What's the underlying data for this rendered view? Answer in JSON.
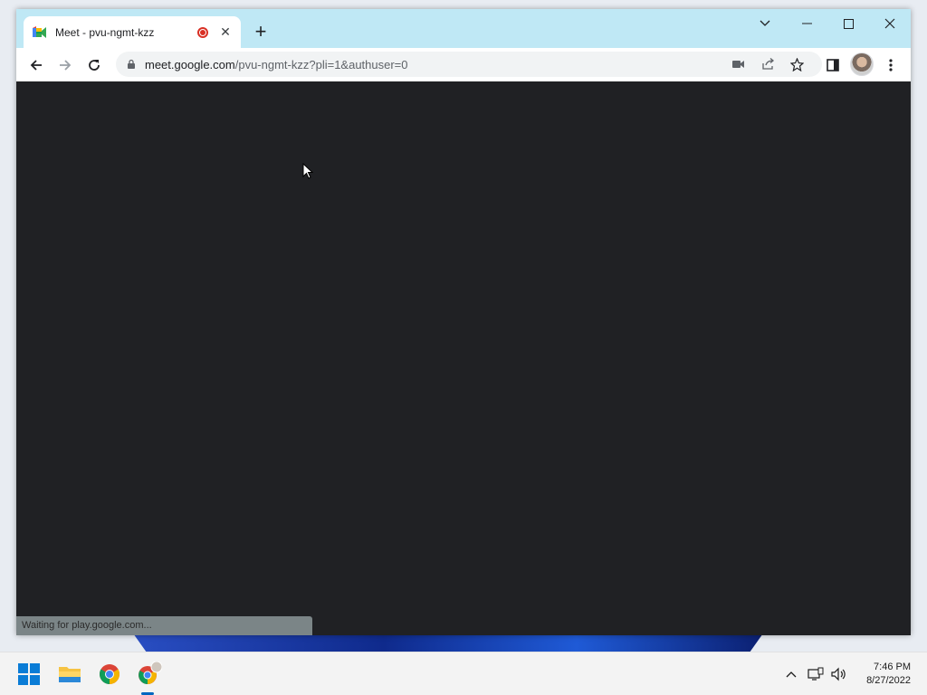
{
  "browser": {
    "tab": {
      "title": "Meet - pvu-ngmt-kzz",
      "recording": true
    },
    "new_tab_label": "+",
    "window_controls": {
      "tab_search": "chevron-down-icon",
      "minimize": "minimize-icon",
      "maximize": "maximize-icon",
      "close": "close-icon"
    },
    "address": {
      "host": "meet.google.com",
      "path": "/pvu-ngmt-kzz?pli=1&authuser=0"
    },
    "status_text": "Waiting for play.google.com..."
  },
  "taskbar": {
    "time": "7:46 PM",
    "date": "8/27/2022"
  },
  "colors": {
    "titlebar": "#bfe8f5",
    "content_bg": "#202124",
    "record_red": "#d93025",
    "taskbar_bg": "#f3f3f3"
  }
}
